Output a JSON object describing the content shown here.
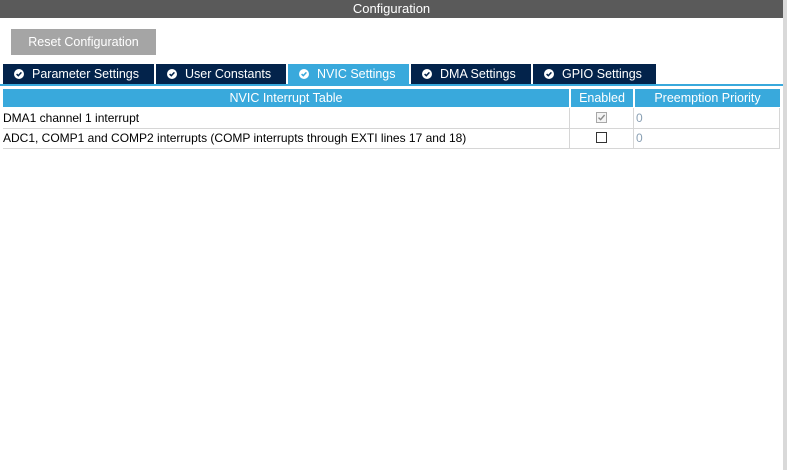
{
  "window": {
    "title": "Configuration"
  },
  "toolbar": {
    "reset_label": "Reset Configuration"
  },
  "tabs": [
    {
      "label": "Parameter Settings",
      "active": false,
      "icon": "check-circle-icon"
    },
    {
      "label": "User Constants",
      "active": false,
      "icon": "check-circle-icon"
    },
    {
      "label": "NVIC Settings",
      "active": true,
      "icon": "check-circle-icon"
    },
    {
      "label": "DMA Settings",
      "active": false,
      "icon": "check-circle-icon"
    },
    {
      "label": "GPIO Settings",
      "active": false,
      "icon": "check-circle-icon"
    }
  ],
  "nvic_table": {
    "columns": [
      "NVIC Interrupt Table",
      "Enabled",
      "Preemption Priority"
    ],
    "rows": [
      {
        "name": "DMA1 channel 1 interrupt",
        "enabled": true,
        "enabled_locked": true,
        "priority": "0"
      },
      {
        "name": "ADC1, COMP1 and COMP2 interrupts (COMP interrupts through EXTI lines 17 and 18)",
        "enabled": false,
        "enabled_locked": false,
        "priority": "0"
      }
    ]
  },
  "colors": {
    "title_bar": "#5a5a5a",
    "tab_inactive": "#03234b",
    "tab_active": "#39a9dc",
    "header": "#39a9dc",
    "priority_text": "#8aa0b4"
  }
}
